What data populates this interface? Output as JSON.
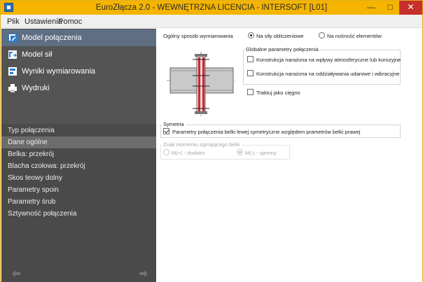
{
  "window": {
    "title": "EuroZłącza 2.0 - WEWNĘTRZNA LICENCIA - INTERSOFT [L01]",
    "controls": {
      "minimize": "—",
      "maximize": "□",
      "close": "✕"
    }
  },
  "menu": [
    "Plik",
    "Ustawienia",
    "Pomoc"
  ],
  "sidebar": {
    "main_items": [
      {
        "label": "Model połączenia",
        "icon": "connection-model-icon",
        "active": true
      },
      {
        "label": "Model sił",
        "icon": "forces-model-icon",
        "active": false
      },
      {
        "label": "Wyniki wymiarowania",
        "icon": "results-icon",
        "active": false
      },
      {
        "label": "Wydruki",
        "icon": "printer-icon",
        "active": false
      }
    ],
    "sub_items": [
      {
        "label": "Typ połączenia",
        "active": false
      },
      {
        "label": "Dane ogólne",
        "active": true
      },
      {
        "label": "Belka: przekrój",
        "active": false
      },
      {
        "label": "Blacha czołowa: przekrój",
        "active": false
      },
      {
        "label": "Skos teowy dolny",
        "active": false
      },
      {
        "label": "Parametry spoin",
        "active": false
      },
      {
        "label": "Parametry śrub",
        "active": false
      },
      {
        "label": "Sztywność połączenia",
        "active": false
      }
    ],
    "nav": {
      "back_icon": "arrow-left-icon",
      "forward_icon": "arrow-right-icon"
    }
  },
  "general": {
    "design_mode_label": "Ogólny sposób wymiarowania",
    "options": [
      {
        "label": "Na siły obliczeniowe",
        "checked": true
      },
      {
        "label": "Na nośność elementów",
        "checked": false
      }
    ]
  },
  "global_params": {
    "title": "Globalne parametry połączenia",
    "checks": [
      {
        "label": "Konstrukcja narażona na wpływy atmosferyczne lub korozyjne",
        "checked": false
      },
      {
        "label": "Konstrukcja narażona na oddziaływania udarowe i wibracyjne",
        "checked": false
      }
    ]
  },
  "tie": {
    "label": "Traktuj jako cięgno",
    "checked": false
  },
  "symmetry": {
    "title": "Symetria",
    "check_label": "Parametry połączenia belki lewej symetryczne względem prametrów belki prawej",
    "checked": true
  },
  "moment_sign": {
    "title": "Znak momentu zginającego belki",
    "options": [
      {
        "label": "M(+) - dodatni",
        "checked": false
      },
      {
        "label": "M(-) - ujemny",
        "checked": true
      }
    ]
  },
  "colors": {
    "titlebar": "#f4b400",
    "close_button": "#c7302a",
    "sidebar": "#545454",
    "sidebar_sub": "#4a4a4a",
    "active_main": "#5e6e83",
    "active_sub": "#6c6c6c",
    "beam_fill": "#c9c9c9",
    "plate": "#d9232d"
  }
}
